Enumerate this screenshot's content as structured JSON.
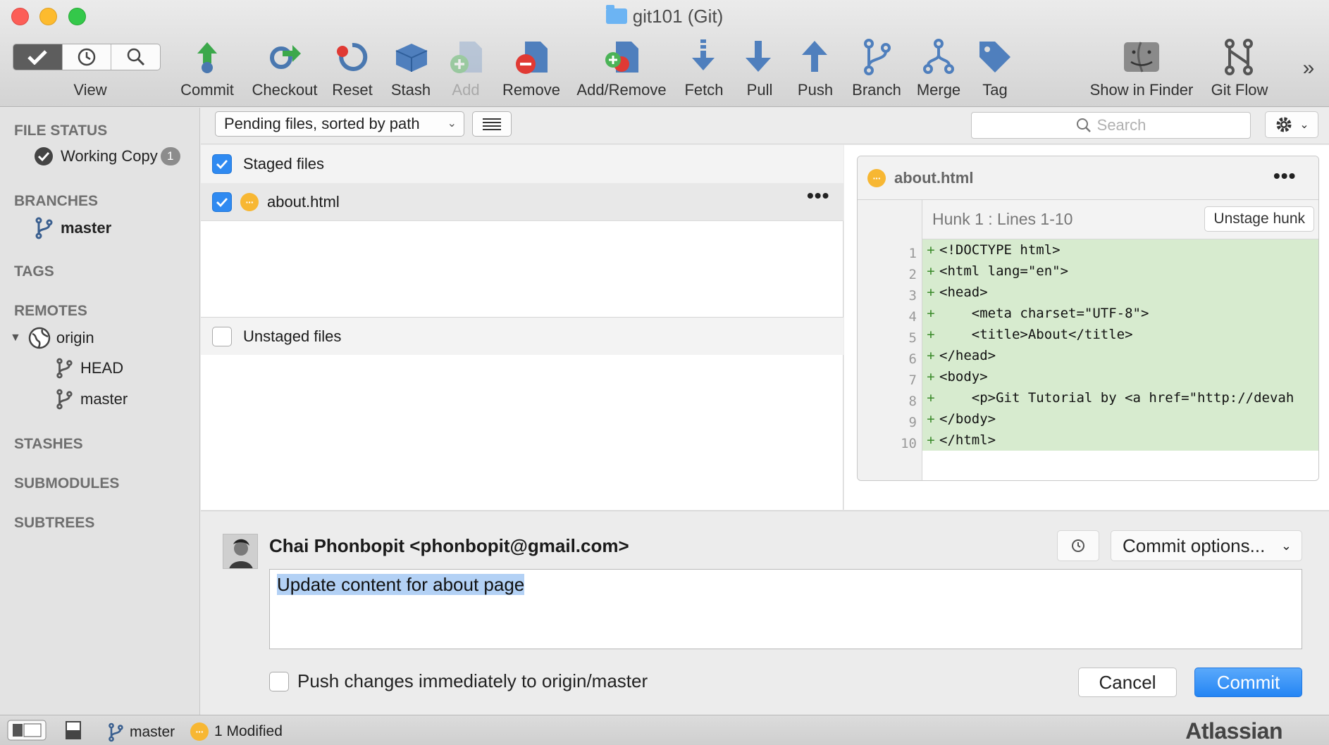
{
  "window": {
    "title": "git101 (Git)"
  },
  "toolbar": {
    "view_label": "View",
    "tools": [
      {
        "label": "Commit",
        "icon": "commit-icon"
      },
      {
        "label": "Checkout",
        "icon": "checkout-icon"
      },
      {
        "label": "Reset",
        "icon": "reset-icon"
      },
      {
        "label": "Stash",
        "icon": "stash-icon"
      },
      {
        "label": "Add",
        "icon": "add-icon",
        "disabled": true
      },
      {
        "label": "Remove",
        "icon": "remove-icon"
      },
      {
        "label": "Add/Remove",
        "icon": "add-remove-icon"
      },
      {
        "label": "Fetch",
        "icon": "fetch-icon"
      },
      {
        "label": "Pull",
        "icon": "pull-icon"
      },
      {
        "label": "Push",
        "icon": "push-icon"
      },
      {
        "label": "Branch",
        "icon": "branch-icon"
      },
      {
        "label": "Merge",
        "icon": "merge-icon"
      },
      {
        "label": "Tag",
        "icon": "tag-icon"
      },
      {
        "label": "Show in Finder",
        "icon": "finder-icon"
      },
      {
        "label": "Git Flow",
        "icon": "git-flow-icon"
      }
    ],
    "overflow": "»"
  },
  "sidebar": {
    "file_status": "FILE STATUS",
    "working_copy": "Working Copy",
    "working_copy_count": "1",
    "branches": "BRANCHES",
    "branch_master": "master",
    "tags": "TAGS",
    "remotes": "REMOTES",
    "remote_origin": "origin",
    "remote_head": "HEAD",
    "remote_master": "master",
    "stashes": "STASHES",
    "submodules": "SUBMODULES",
    "subtrees": "SUBTREES"
  },
  "filebar": {
    "sort_label": "Pending files, sorted by path",
    "search_placeholder": "Search"
  },
  "files": {
    "staged_label": "Staged files",
    "staged_file": "about.html",
    "unstaged_label": "Unstaged files"
  },
  "diff": {
    "file": "about.html",
    "hunk_label": "Hunk 1 : Lines 1-10",
    "unstage_label": "Unstage hunk",
    "lines": [
      {
        "num": "1",
        "text": "<!DOCTYPE html>"
      },
      {
        "num": "2",
        "text": "<html lang=\"en\">"
      },
      {
        "num": "3",
        "text": "<head>"
      },
      {
        "num": "4",
        "text": "    <meta charset=\"UTF-8\">"
      },
      {
        "num": "5",
        "text": "    <title>About</title>"
      },
      {
        "num": "6",
        "text": "</head>"
      },
      {
        "num": "7",
        "text": "<body>"
      },
      {
        "num": "8",
        "text": "    <p>Git Tutorial by <a href=\"http://devah"
      },
      {
        "num": "9",
        "text": "</body>"
      },
      {
        "num": "10",
        "text": "</html>"
      }
    ]
  },
  "commit": {
    "author": "Chai Phonbopit <phonbopit@gmail.com>",
    "options_label": "Commit options...",
    "message": "Update content for about page",
    "push_label": "Push changes immediately to origin/master",
    "cancel_label": "Cancel",
    "commit_label": "Commit"
  },
  "status": {
    "branch": "master",
    "modified": "1 Modified",
    "brand": "Atlassian"
  },
  "colors": {
    "accent": "#2f8af1",
    "added_line": "#d7ebcf",
    "pending": "#f7b733"
  }
}
